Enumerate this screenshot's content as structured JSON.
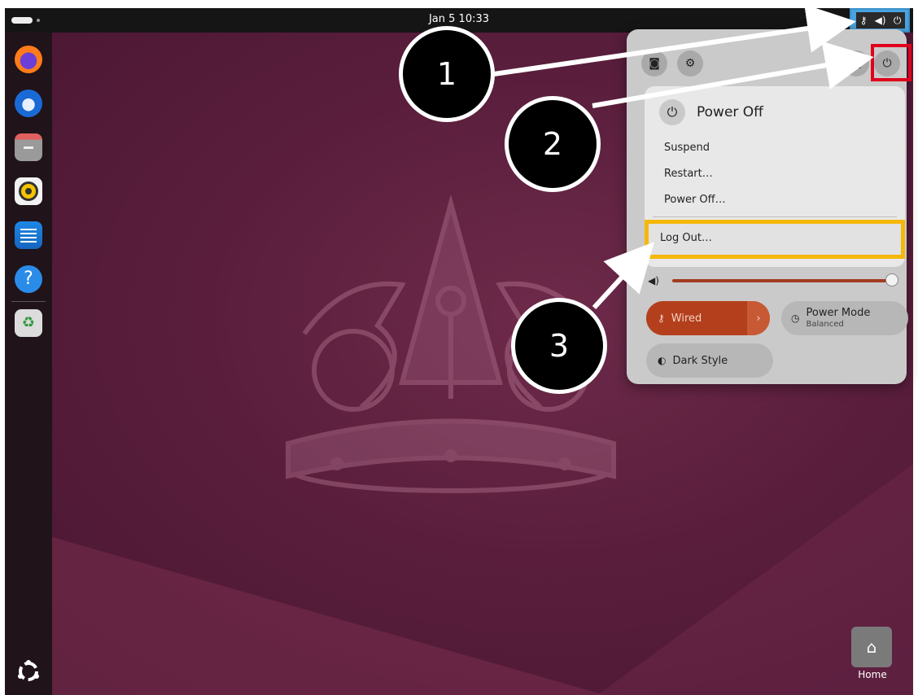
{
  "topbar": {
    "clock": "Jan 5  10:33",
    "tray_icons": [
      "network-icon",
      "volume-icon",
      "power-icon"
    ]
  },
  "dock": {
    "apps": [
      "firefox-icon",
      "thunderbird-icon",
      "files-icon",
      "rhythmbox-icon",
      "writer-icon",
      "help-icon",
      "trash-icon"
    ],
    "show_apps_icon": "ubuntu-logo-icon"
  },
  "quick_settings": {
    "top_buttons": [
      "screenshot-icon",
      "settings-icon",
      "lock-icon",
      "power-icon"
    ],
    "power_menu": {
      "title": "Power Off",
      "items": [
        "Suspend",
        "Restart…",
        "Power Off…"
      ],
      "logout": "Log Out…"
    },
    "volume_level": 1.0,
    "tiles": {
      "wired": "Wired",
      "power_mode": "Power Mode",
      "power_mode_value": "Balanced",
      "dark_style": "Dark Style"
    }
  },
  "desktop": {
    "home_label": "Home"
  },
  "callouts": [
    "1",
    "2",
    "3"
  ],
  "colors": {
    "accent": "#b43f1c",
    "highlight_red": "#e0001b",
    "highlight_yellow": "#f5b70a",
    "highlight_blue": "#4aa3df"
  }
}
